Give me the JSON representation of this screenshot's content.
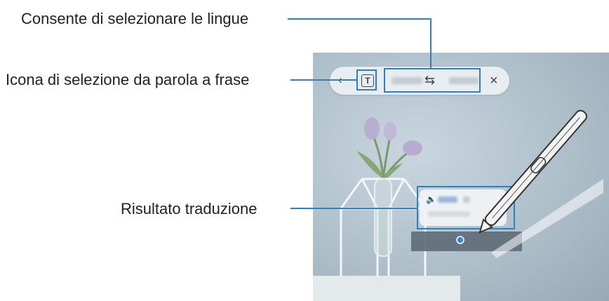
{
  "callouts": {
    "languages": "Consente di selezionare le lingue",
    "word_sentence_icon": "Icona di selezione da parola a frase",
    "result": "Risultato traduzione"
  },
  "toolbar": {
    "collapse_icon": "chevron-left-icon",
    "text_icon": "T",
    "swap_icon": "swap-icon",
    "close_icon": "×"
  },
  "colors": {
    "callout_line": "#2f7fc1"
  }
}
